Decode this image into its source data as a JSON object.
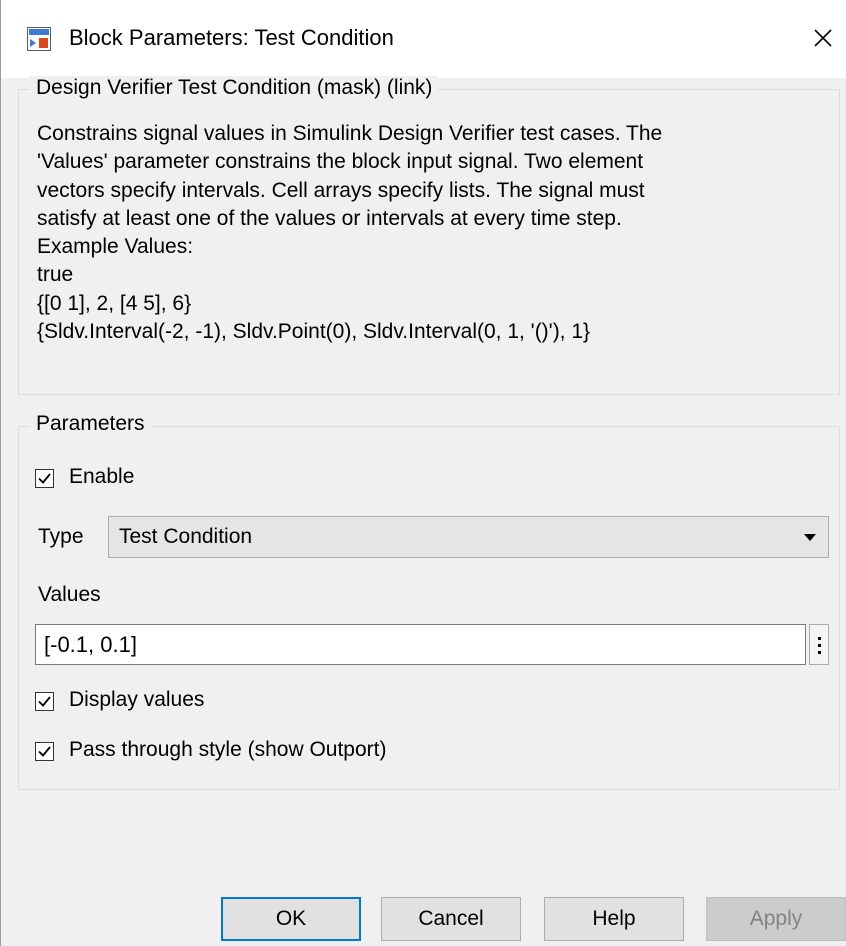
{
  "window": {
    "title": "Block Parameters: Test Condition",
    "icon": "simulink-block-icon",
    "close_icon": "close-icon"
  },
  "description_group": {
    "legend": "Design Verifier Test Condition (mask) (link)",
    "text": "Constrains signal values in Simulink Design Verifier test cases. The\n'Values' parameter constrains the block input signal.  Two element\nvectors specify intervals.  Cell arrays specify lists.  The signal must\nsatisfy at least one of the values or intervals at every time step.\nExample Values:\ntrue\n{[0 1], 2, [4 5], 6}\n{Sldv.Interval(-2, -1), Sldv.Point(0), Sldv.Interval(0, 1, '()'), 1}"
  },
  "parameters_group": {
    "legend": "Parameters",
    "enable": {
      "label": "Enable",
      "checked": true
    },
    "type": {
      "label": "Type",
      "selected": "Test Condition"
    },
    "values": {
      "label": "Values",
      "value": "[-0.1, 0.1]"
    },
    "display_values": {
      "label": "Display values",
      "checked": true
    },
    "pass_through": {
      "label": "Pass through style (show Outport)",
      "checked": true
    }
  },
  "buttons": {
    "ok": "OK",
    "cancel": "Cancel",
    "help": "Help",
    "apply": "Apply"
  },
  "colors": {
    "default_button_border": "#0078d7",
    "dialog_background": "#f0f0f0",
    "disabled_text": "#838383"
  }
}
